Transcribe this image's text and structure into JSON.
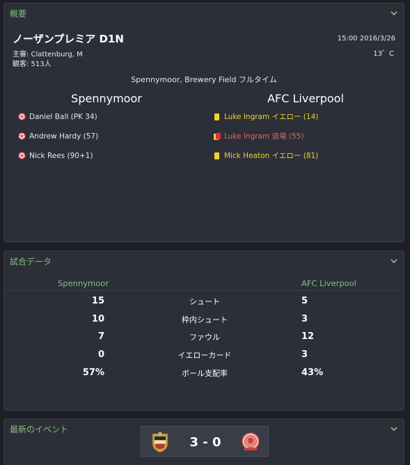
{
  "overview": {
    "title": "概要",
    "league": "ノーザンプレミア D1N",
    "referee": "主審: Clattenburg, M",
    "attendance": "観客: 513人",
    "datetime": "15:00 2016/3/26",
    "temperature": "13゜C",
    "venue": "Spennymoor, Brewery Field フルタイム",
    "home_team": "Spennymoor",
    "away_team": "AFC Liverpool",
    "home_events": [
      {
        "icon": "football-icon",
        "text": "Daniel Ball (PK 34)"
      },
      {
        "icon": "football-icon",
        "text": "Andrew Hardy (57)"
      },
      {
        "icon": "football-icon",
        "text": "Nick Rees (90+1)"
      }
    ],
    "away_events": [
      {
        "icon": "yellow-card-icon",
        "text": "Luke Ingram イエロー (14)"
      },
      {
        "icon": "second-yellow-red-card-icon",
        "text": "Luke Ingram 退場 (55)"
      },
      {
        "icon": "yellow-card-icon",
        "text": "Mick Heaton イエロー (81)"
      }
    ]
  },
  "stats": {
    "title": "試合データ",
    "home_team": "Spennymoor",
    "away_team": "AFC Liverpool",
    "rows": [
      {
        "label": "シュート",
        "home": "15",
        "away": "5"
      },
      {
        "label": "枠内シュート",
        "home": "10",
        "away": "3"
      },
      {
        "label": "ファウル",
        "home": "7",
        "away": "12"
      },
      {
        "label": "イエローカード",
        "home": "0",
        "away": "3"
      },
      {
        "label": "ボール支配率",
        "home": "57%",
        "away": "43%"
      }
    ]
  },
  "latest": {
    "title": "最新のイベント",
    "score": "3 - 0",
    "home_crest": "spennymoor-crest-icon",
    "away_crest": "afc-liverpool-crest-icon"
  },
  "colors": {
    "accent_green": "#7fbf7f",
    "yellow": "#f1d12e",
    "red": "#e0676a",
    "panel_bg": "#2c2f38",
    "page_bg": "#1c1f26"
  }
}
